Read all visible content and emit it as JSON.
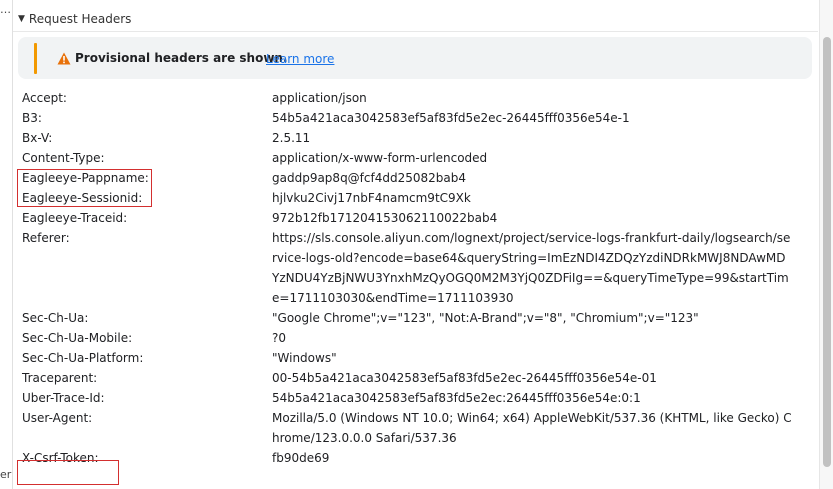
{
  "gutter": {
    "top_text": "…",
    "bottom_text": "er"
  },
  "section": {
    "triangle": "▼",
    "title": "Request Headers"
  },
  "banner": {
    "accent_color": "#f29900",
    "icon": "warning-icon",
    "message": "Provisional headers are shown.",
    "link": "Learn more"
  },
  "headers": [
    {
      "name": "Accept:",
      "value": "application/json"
    },
    {
      "name": "B3:",
      "value": "54b5a421aca3042583ef5af83fd5e2ec-26445fff0356e54e-1"
    },
    {
      "name": "Bx-V:",
      "value": "2.5.11"
    },
    {
      "name": "Content-Type:",
      "value": "application/x-www-form-urlencoded"
    },
    {
      "name": "Eagleeye-Pappname:",
      "value": "gaddp9ap8q@fcf4dd25082bab4"
    },
    {
      "name": "Eagleeye-Sessionid:",
      "value": "hjlvku2Civj17nbF4namcm9tC9Xk"
    },
    {
      "name": "Eagleeye-Traceid:",
      "value": "972b12fb171204153062110022bab4"
    },
    {
      "name": "Referer:",
      "value": "https://sls.console.aliyun.com/lognext/project/service-logs-frankfurt-daily/logsearch/service-logs-old?encode=base64&queryString=ImEzNDI4ZDQzYzdiNDRkMWJ8NDAwMDYzNDU4YzBjNWU3YnxhMzQyOGQ0M2M3YjQ0ZDFiIg==&queryTimeType=99&startTime=1711103030&endTime=1711103930"
    },
    {
      "name": "Sec-Ch-Ua:",
      "value": "\"Google Chrome\";v=\"123\", \"Not:A-Brand\";v=\"8\", \"Chromium\";v=\"123\""
    },
    {
      "name": "Sec-Ch-Ua-Mobile:",
      "value": "?0"
    },
    {
      "name": "Sec-Ch-Ua-Platform:",
      "value": "\"Windows\""
    },
    {
      "name": "Traceparent:",
      "value": "00-54b5a421aca3042583ef5af83fd5e2ec-26445fff0356e54e-01"
    },
    {
      "name": "Uber-Trace-Id:",
      "value": "54b5a421aca3042583ef5af83fd5e2ec:26445fff0356e54e:0:1"
    },
    {
      "name": "User-Agent:",
      "value": "Mozilla/5.0 (Windows NT 10.0; Win64; x64) AppleWebKit/537.36 (KHTML, like Gecko) Chrome/123.0.0.0 Safari/537.36"
    },
    {
      "name": "X-Csrf-Token:",
      "value": "fb90de69"
    }
  ],
  "annotation_color": "#d32f2f"
}
